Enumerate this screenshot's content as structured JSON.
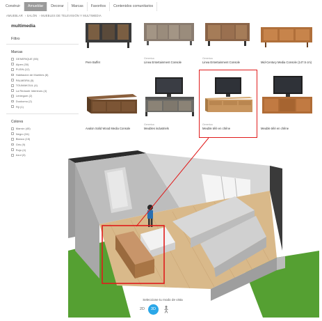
{
  "nav": {
    "tabs": [
      "Construir",
      "Amueblar",
      "Decorar",
      "Marcas",
      "Favoritos",
      "Contenidos comunitarios"
    ],
    "active": "Amueblar"
  },
  "breadcrumb": [
    "AMUEBLAR",
    "SALÓN",
    "MUEBLES DE TELEVISIÓN Y MULTIMEDIA"
  ],
  "sidebar": {
    "title": "multimedia",
    "filter_label": "Filtro",
    "brands_heading": "Marcas",
    "brands": [
      "GENERIQUE (55)",
      "Alpen (30)",
      "PLEIN (12)",
      "Habitación de Muebles (8)",
      "PALMEIRA (5)",
      "TOUMAKOUL (4)",
      "La Redoute Interieurs (4)",
      "Lenlegum (2)",
      "Duokomu (2)",
      "Fiji (1)"
    ],
    "colors_heading": "Colores",
    "colors": [
      "Marrón (45)",
      "Negro (34)",
      "Blanco (15)",
      "Gris (9)",
      "Rojo (4)",
      "Azul (3)"
    ]
  },
  "products": {
    "row1": [
      {
        "brand": "",
        "name": "Pere Buffet"
      },
      {
        "brand": "Generica",
        "name": "Linea Entertainment Console"
      },
      {
        "brand": "Generica",
        "name": "Linea Entertainment Console"
      },
      {
        "brand": "",
        "name": "Mid-Century Media Console (147.5 cm)"
      }
    ],
    "row2": [
      {
        "brand": "",
        "name": "Avalon Solid Wood Media Console"
      },
      {
        "brand": "Generica",
        "name": "Meubles industriels"
      },
      {
        "brand": "Generica",
        "name": "Meuble télé en chêne"
      },
      {
        "brand": "",
        "name": "Meuble télé en chêne"
      }
    ]
  },
  "viewmode": {
    "label": "Seleccione tu modo de vista",
    "option_2d": "2D",
    "option_3d": "3D",
    "selected": "3D"
  },
  "colors": {
    "nav_active": "#9a9a9a",
    "highlight": "#e01b1b",
    "view_selected": "#2aa7e8",
    "grass": "#55a032",
    "wood": "#c8956a"
  }
}
